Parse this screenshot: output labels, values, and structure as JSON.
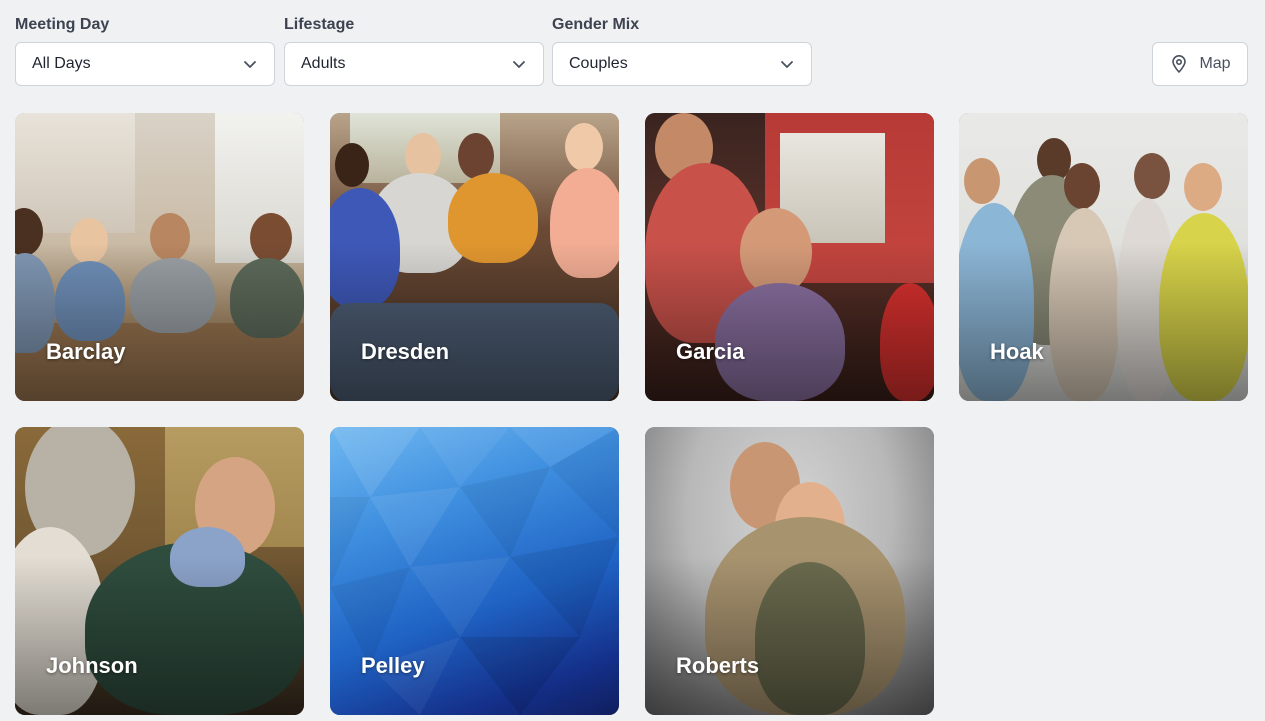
{
  "filters": [
    {
      "label": "Meeting Day",
      "value": "All Days"
    },
    {
      "label": "Lifestage",
      "value": "Adults"
    },
    {
      "label": "Gender Mix",
      "value": "Couples"
    }
  ],
  "map_button": {
    "label": "Map",
    "icon": "map-pin-icon"
  },
  "groups": [
    {
      "name": "Barclay"
    },
    {
      "name": "Dresden"
    },
    {
      "name": "Garcia"
    },
    {
      "name": "Hoak"
    },
    {
      "name": "Johnson"
    },
    {
      "name": "Pelley"
    },
    {
      "name": "Roberts"
    }
  ]
}
